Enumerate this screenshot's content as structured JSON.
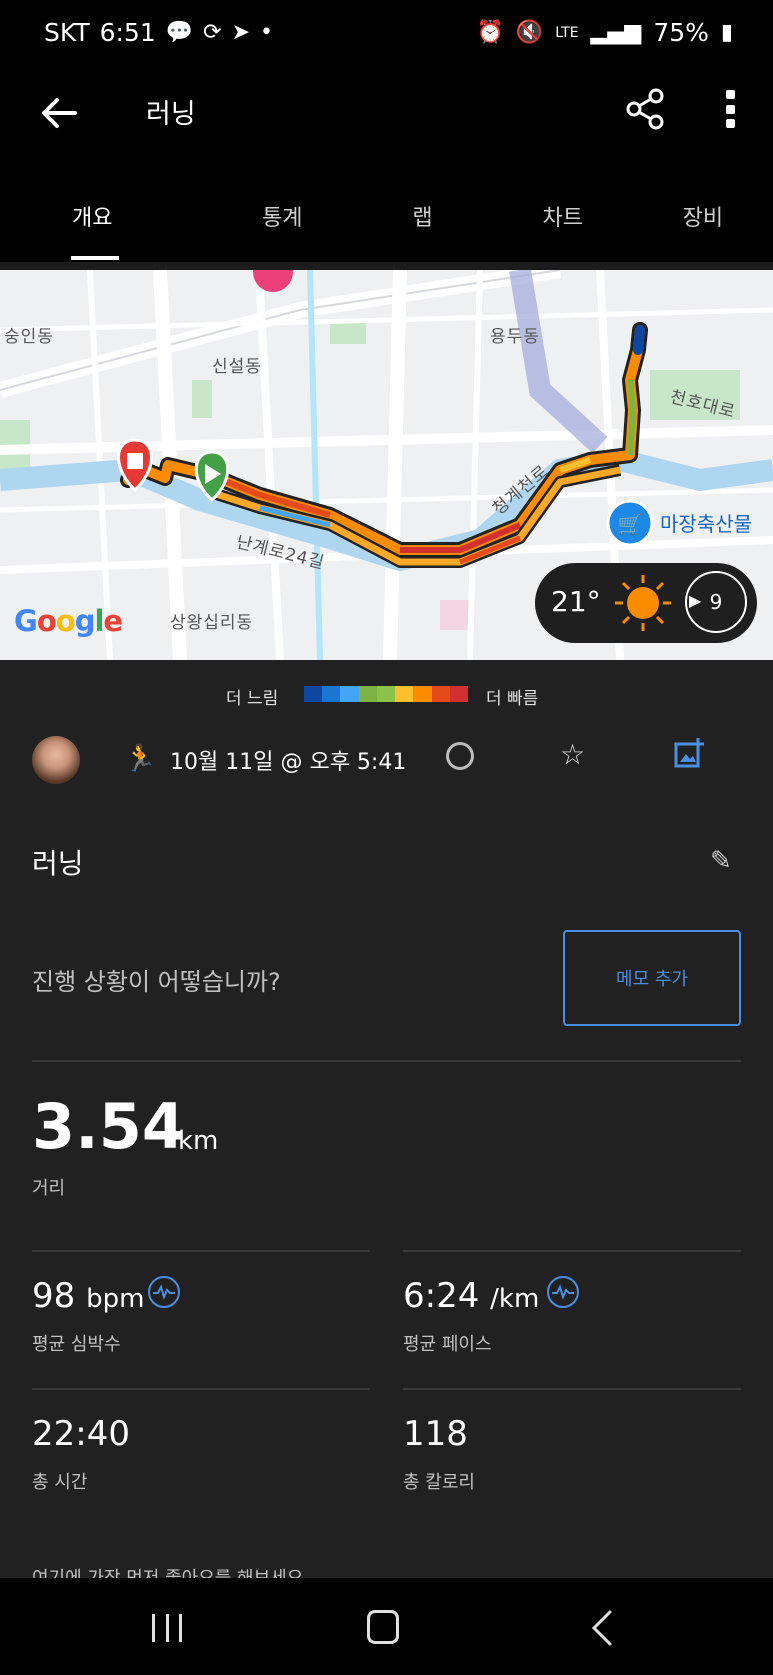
{
  "status": {
    "carrier": "SKT",
    "time": "6:51",
    "network": "LTE",
    "battery": "75%"
  },
  "app_bar": {
    "title": "러닝"
  },
  "tabs": [
    {
      "label": "개요",
      "active": true
    },
    {
      "label": "통계",
      "active": false
    },
    {
      "label": "랩",
      "active": false
    },
    {
      "label": "차트",
      "active": false
    },
    {
      "label": "장비",
      "active": false
    }
  ],
  "map": {
    "labels": {
      "seungin": "숭인동",
      "sinseol": "신설동",
      "yongdu": "용두동",
      "cheonho": "천호대로",
      "sangwang": "상왕십리동",
      "cheonggye": "청계천로",
      "nangye": "난계로24길",
      "shop": "마장축산물"
    },
    "google": "Google",
    "weather": {
      "temperature": "21°",
      "wind": "9"
    }
  },
  "legend": {
    "slow": "더 느림",
    "fast": "더 빠름",
    "colors": [
      "#0d47a1",
      "#1976d2",
      "#42a5f5",
      "#7cb342",
      "#8bc34a",
      "#fbc02d",
      "#fb8c00",
      "#e64a19",
      "#d32f2f"
    ]
  },
  "workout": {
    "date": "10월 11일 @ 오후 5:41",
    "title": "러닝",
    "prompt": "진행 상황이 어떻습니까?",
    "memo_button": "메모 추가"
  },
  "distance": {
    "value": "3.54",
    "unit": "km",
    "label": "거리"
  },
  "stats": {
    "heart_rate": {
      "value": "98",
      "unit": "bpm",
      "label": "평균 심박수"
    },
    "pace": {
      "value": "6:24",
      "unit": "/km",
      "label": "평균 페이스"
    },
    "duration": {
      "value": "22:40",
      "label": "총 시간"
    },
    "calories": {
      "value": "118",
      "label": "총 칼로리"
    }
  },
  "footer_prompt": "여기에 가장 먼저 좋아요를 해보세요"
}
